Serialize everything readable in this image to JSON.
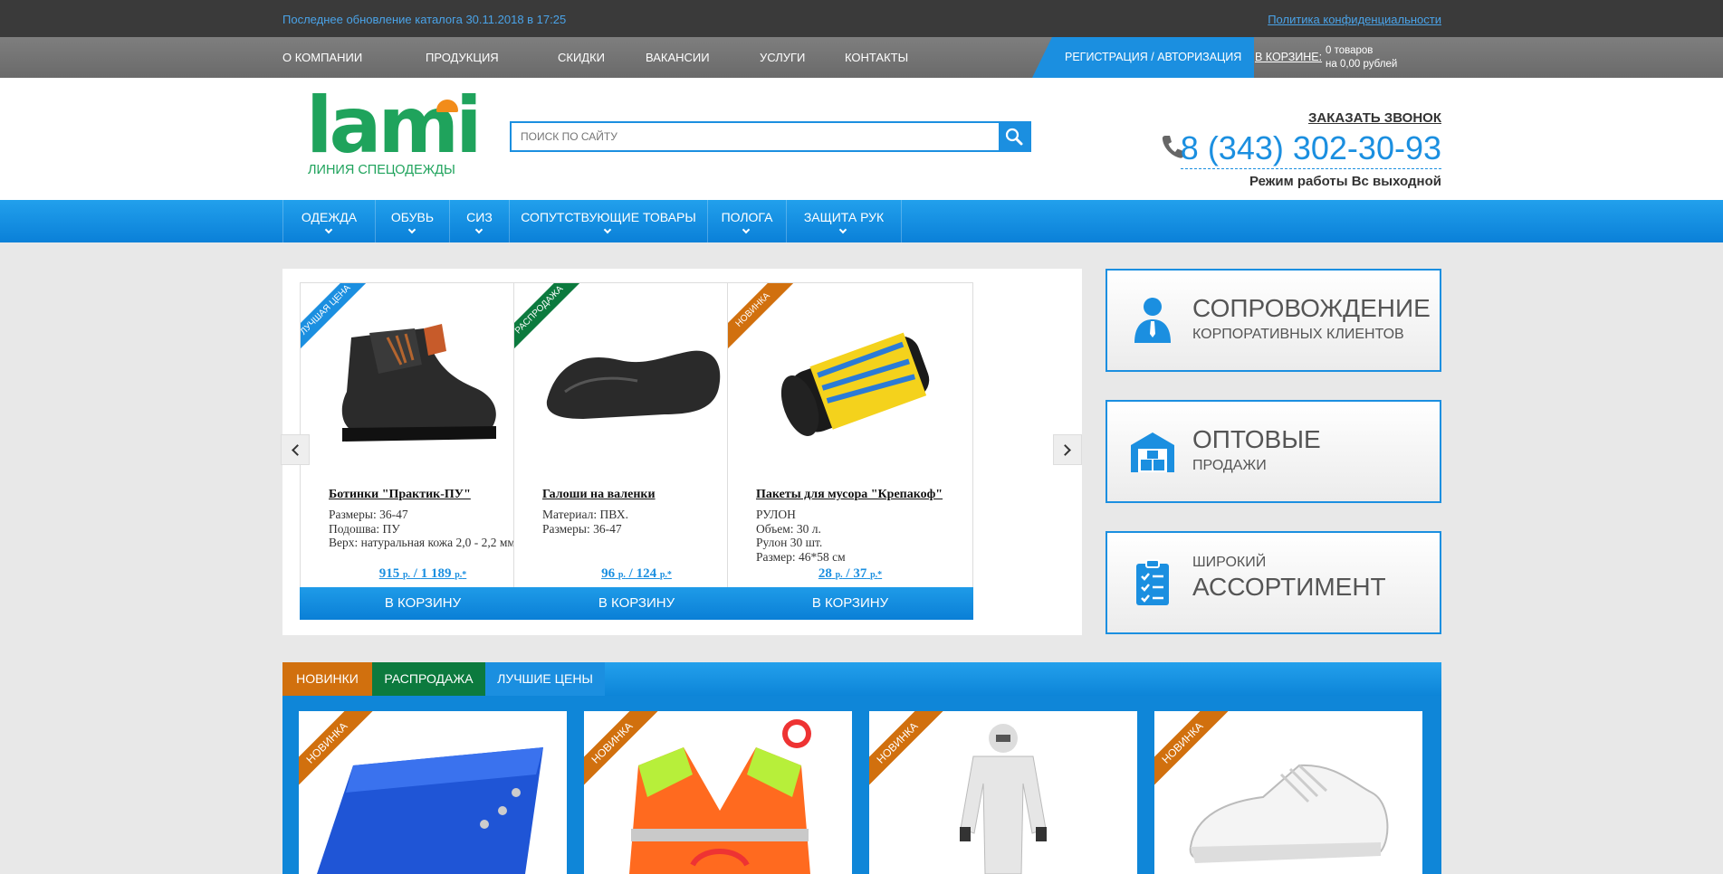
{
  "topbar": {
    "update_text": "Последнее обновление каталога 30.11.2018 в 17:25",
    "privacy_link": "Политика конфиденциальности"
  },
  "menu": {
    "items": [
      "О КОМПАНИИ",
      "ПРОДУКЦИЯ",
      "СКИДКИ",
      "ВАКАНСИИ",
      "УСЛУГИ",
      "КОНТАКТЫ"
    ],
    "register_label": "РЕГИСТРАЦИЯ / АВТОРИЗАЦИЯ",
    "cart_label": "В КОРЗИНЕ:",
    "cart_count": "0 товаров",
    "cart_sum": "на 0,00 рублей"
  },
  "header": {
    "logo_word": "lami",
    "logo_tagline": "ЛИНИЯ СПЕЦОДЕЖДЫ",
    "search_placeholder": "ПОИСК ПО САЙТУ",
    "callback_label": "ЗАКАЗАТЬ ЗВОНОК",
    "phone": "8 (343) 302-30-93",
    "hours": "Режим работы Вс выходной"
  },
  "nav": {
    "categories": [
      "ОДЕЖДА",
      "ОБУВЬ",
      "СИЗ",
      "СОПУТСТВУЮЩИЕ ТОВАРЫ",
      "ПОЛОГА",
      "ЗАЩИТА РУК"
    ]
  },
  "carousel": {
    "products": [
      {
        "badge": "ЛУЧШАЯ ЦЕНА",
        "badge_color": "#1b8fe0",
        "title": "Ботинки \"Практик-ПУ\"",
        "specs": [
          "Размеры: 36-47",
          "Подошва: ПУ",
          "Верх: натуральная кожа 2,0 - 2,2 мм"
        ],
        "price1": "915",
        "price2": "1 189",
        "currency": "р.",
        "buy_label": "В КОРЗИНУ"
      },
      {
        "badge": "РАСПРОДАЖА",
        "badge_color": "#0c7a3e",
        "title": "Галоши на валенки",
        "specs": [
          "Материал: ПВХ.",
          "Размеры: 36-47"
        ],
        "price1": "96",
        "price2": "124",
        "currency": "р.",
        "buy_label": "В КОРЗИНУ"
      },
      {
        "badge": "НОВИНКА",
        "badge_color": "#d1700e",
        "title": "Пакеты для мусора \"Крепакоф\"",
        "specs": [
          "РУЛОН",
          "Объем: 30 л.",
          "Рулон 30 шт.",
          "Размер: 46*58 см"
        ],
        "price1": "28",
        "price2": "37",
        "currency": "р.",
        "buy_label": "В КОРЗИНУ"
      }
    ]
  },
  "promos": [
    {
      "big": "СОПРОВОЖДЕНИЕ",
      "small": "КОРПОРАТИВНЫХ КЛИЕНТОВ",
      "icon": "person-icon"
    },
    {
      "big": "ОПТОВЫЕ",
      "small": "ПРОДАЖИ",
      "icon": "warehouse-icon"
    },
    {
      "small": "ШИРОКИЙ",
      "big": "АССОРТИМЕНТ",
      "icon": "checklist-icon"
    }
  ],
  "tabs": {
    "items": [
      "НОВИНКИ",
      "РАСПРОДАЖА",
      "ЛУЧШИЕ ЦЕНЫ"
    ],
    "colors": [
      "#d1700e",
      "#0c7a3e",
      "#1b8fe0"
    ],
    "card_badge": "НОВИНКА"
  },
  "colors": {
    "accent": "#1b8fe0",
    "brand_green": "#1fa35c",
    "orange": "#d1700e"
  }
}
